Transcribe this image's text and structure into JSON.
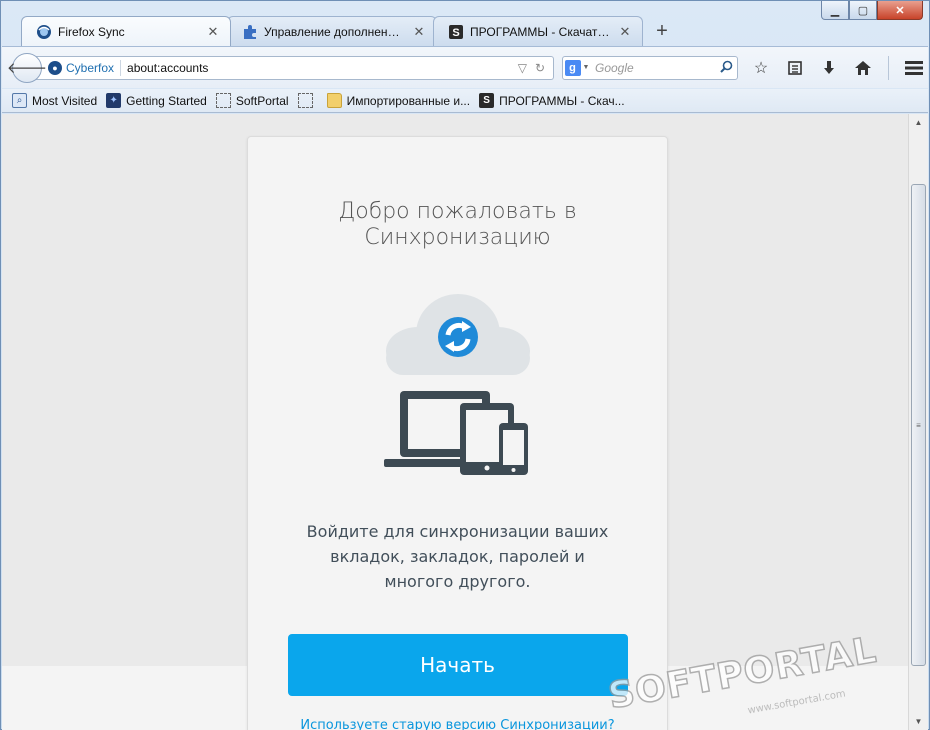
{
  "window": {
    "controls": {
      "minimize": "▁",
      "maximize": "▢",
      "close": "✕"
    }
  },
  "tabs": [
    {
      "title": "Firefox Sync",
      "icon": "firefox-sync-icon",
      "active": true,
      "close": "✕"
    },
    {
      "title": "Управление дополнениями",
      "icon": "puzzle-icon",
      "active": false,
      "close": "✕"
    },
    {
      "title": "ПРОГРАММЫ - Скачать б...",
      "icon": "softportal-icon",
      "active": false,
      "close": "✕"
    }
  ],
  "new_tab_label": "+",
  "navbar": {
    "identity_label": "Cyberfox",
    "url": "about:accounts",
    "search_placeholder": "Google",
    "search_engine_letter": "g"
  },
  "bookmarks": [
    {
      "label": "Most Visited",
      "icon": "most-visited-icon"
    },
    {
      "label": "Getting Started",
      "icon": "getting-started-icon"
    },
    {
      "label": "SoftPortal",
      "icon": "dashed-bookmark-icon"
    },
    {
      "label": "",
      "icon": "dashed-bookmark-icon"
    },
    {
      "label": "Импортированные и...",
      "icon": "folder-icon"
    },
    {
      "label": "ПРОГРАММЫ - Скач...",
      "icon": "softportal-icon"
    }
  ],
  "card": {
    "title": "Добро пожаловать в Синхронизацию",
    "description": "Войдите для синхронизации ваших вкладок, закладок, паролей и многого другого.",
    "start_button": "Начать",
    "old_version_link": "Используете старую версию Синхронизации?"
  },
  "watermark": {
    "brand_text": "SOFTPORTAL",
    "url_text": "www.softportal.com"
  },
  "colors": {
    "primary_button": "#0aa6ec",
    "link": "#0a96dd",
    "device_dark": "#3d4a53",
    "sync_blue": "#1f8ad8"
  }
}
